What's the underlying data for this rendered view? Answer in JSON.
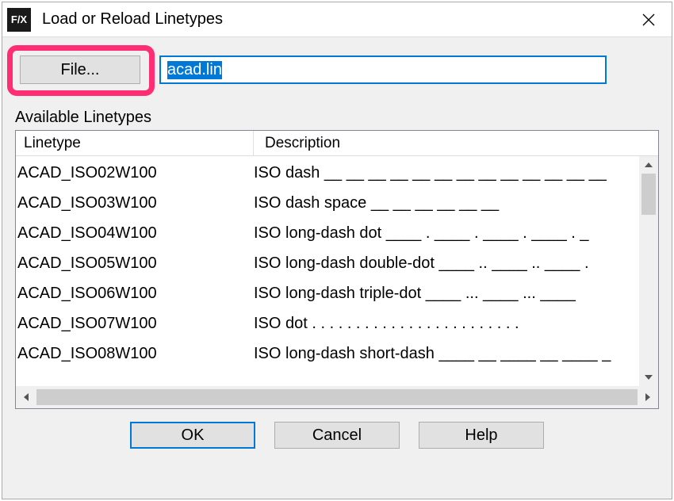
{
  "title": "Load or Reload Linetypes",
  "logo_text": "F/X",
  "file_button_label": "File...",
  "file_input_value": "acad.lin",
  "section_label": "Available Linetypes",
  "headers": {
    "linetype": "Linetype",
    "description": "Description"
  },
  "rows": [
    {
      "linetype": "ACAD_ISO02W100",
      "description": "ISO dash __ __ __ __ __ __ __ __ __ __ __ __ __"
    },
    {
      "linetype": "ACAD_ISO03W100",
      "description": "ISO dash space __    __    __    __    __    __"
    },
    {
      "linetype": "ACAD_ISO04W100",
      "description": "ISO long-dash dot ____ . ____ . ____ . ____ . _"
    },
    {
      "linetype": "ACAD_ISO05W100",
      "description": "ISO long-dash double-dot ____ .. ____ .. ____ ."
    },
    {
      "linetype": "ACAD_ISO06W100",
      "description": "ISO long-dash triple-dot ____ ... ____ ... ____"
    },
    {
      "linetype": "ACAD_ISO07W100",
      "description": "ISO dot . . . . . . . . . . . . . . . . . . . . . . . ."
    },
    {
      "linetype": "ACAD_ISO08W100",
      "description": "ISO long-dash short-dash ____ __ ____ __ ____ _"
    }
  ],
  "buttons": {
    "ok": "OK",
    "cancel": "Cancel",
    "help": "Help"
  }
}
